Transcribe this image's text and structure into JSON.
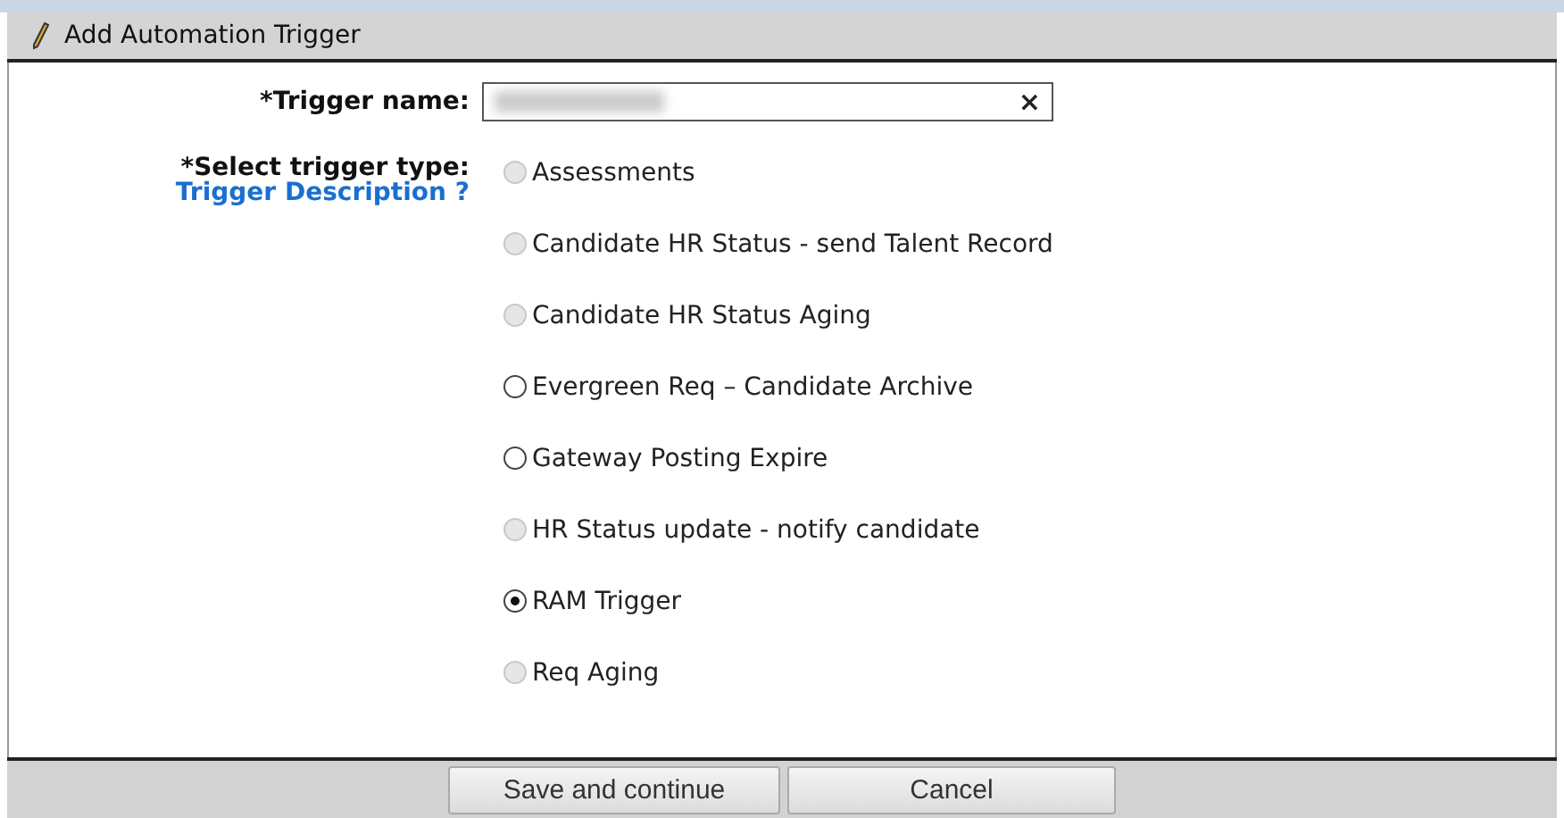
{
  "window": {
    "title": "Add Automation Trigger"
  },
  "trigger_name": {
    "label": "*Trigger name:",
    "clear": "×"
  },
  "trigger_type": {
    "label": "*Select trigger type:",
    "help_link": "Trigger Description ?",
    "options": [
      {
        "label": "Assessments",
        "selected": false,
        "disabled": true
      },
      {
        "label": "Candidate HR Status - send Talent Record",
        "selected": false,
        "disabled": true
      },
      {
        "label": "Candidate HR Status Aging",
        "selected": false,
        "disabled": true
      },
      {
        "label": "Evergreen Req – Candidate Archive",
        "selected": false,
        "disabled": false
      },
      {
        "label": "Gateway Posting Expire",
        "selected": false,
        "disabled": false
      },
      {
        "label": "HR Status update - notify candidate",
        "selected": false,
        "disabled": true
      },
      {
        "label": "RAM Trigger",
        "selected": true,
        "disabled": false
      },
      {
        "label": "Req Aging",
        "selected": false,
        "disabled": true
      }
    ]
  },
  "buttons": [
    "Save and continue",
    "Cancel"
  ]
}
